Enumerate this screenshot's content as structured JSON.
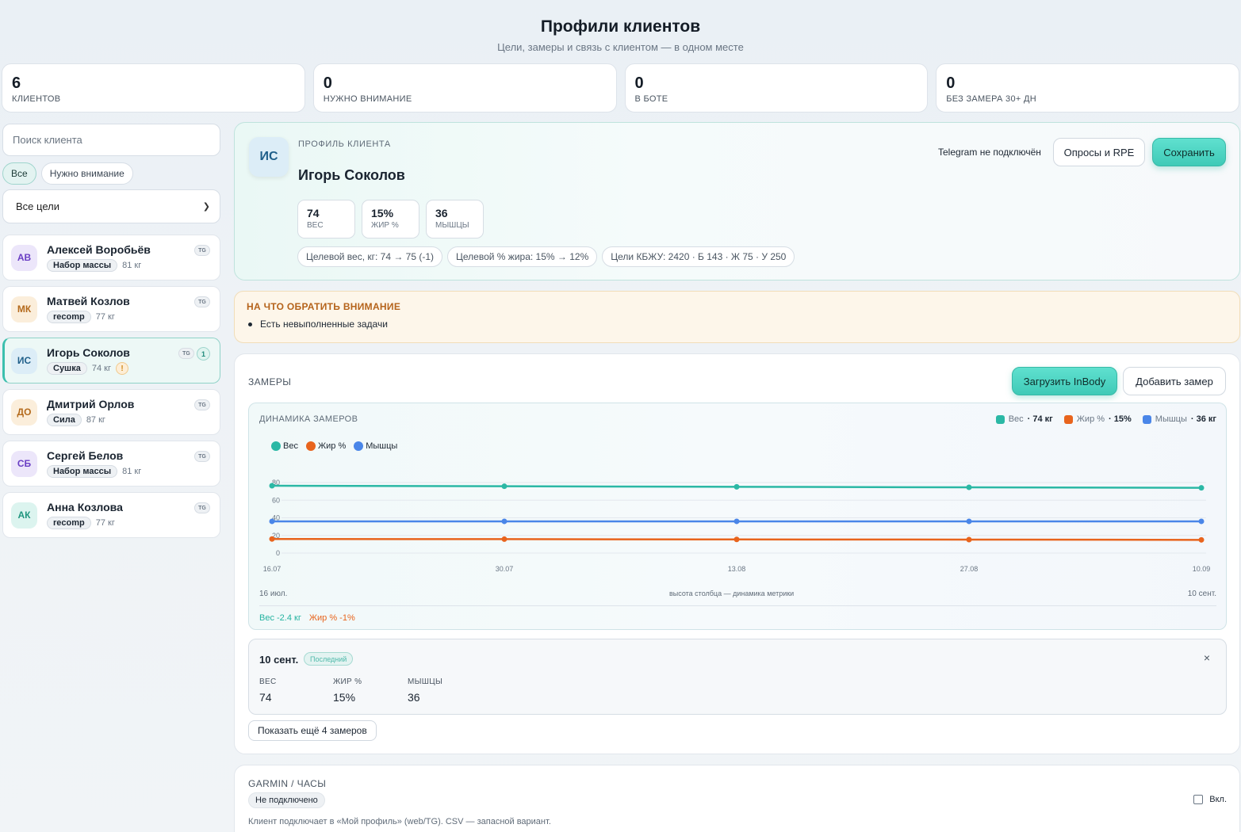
{
  "header": {
    "title": "Профили клиентов",
    "subtitle": "Цели, замеры и связь с клиентом — в одном месте"
  },
  "stats": [
    {
      "value": "6",
      "label": "КЛИЕНТОВ"
    },
    {
      "value": "0",
      "label": "НУЖНО ВНИМАНИЕ"
    },
    {
      "value": "0",
      "label": "В БОТЕ"
    },
    {
      "value": "0",
      "label": "БЕЗ ЗАМЕРА 30+ ДН"
    }
  ],
  "sidebar": {
    "search_placeholder": "Поиск клиента",
    "filters": [
      "Все",
      "Нужно внимание"
    ],
    "goal_select": "Все цели",
    "clients": [
      {
        "initials": "АВ",
        "name": "Алексей Воробьёв",
        "goal": "Набор массы",
        "weight": "81 кг",
        "tg": "TG",
        "avatar_bg": "#ece6fa",
        "avatar_fg": "#6a3fc4"
      },
      {
        "initials": "МК",
        "name": "Матвей Козлов",
        "goal": "recomp",
        "weight": "77 кг",
        "tg": "TG",
        "avatar_bg": "#fbeedb",
        "avatar_fg": "#b46a1c"
      },
      {
        "initials": "ИС",
        "name": "Игорь Соколов",
        "goal": "Сушка",
        "weight": "74 кг",
        "tg": "TG",
        "count": "1",
        "warn": "!",
        "avatar_bg": "#dcedf7",
        "avatar_fg": "#1f5f8a"
      },
      {
        "initials": "ДО",
        "name": "Дмитрий Орлов",
        "goal": "Сила",
        "weight": "87 кг",
        "tg": "TG",
        "avatar_bg": "#fbeedb",
        "avatar_fg": "#b46a1c"
      },
      {
        "initials": "СБ",
        "name": "Сергей Белов",
        "goal": "Набор массы",
        "weight": "81 кг",
        "tg": "TG",
        "avatar_bg": "#ece6fa",
        "avatar_fg": "#6a3fc4"
      },
      {
        "initials": "АК",
        "name": "Анна Козлова",
        "goal": "recomp",
        "weight": "77 кг",
        "tg": "TG",
        "avatar_bg": "#dcf4ef",
        "avatar_fg": "#21967f"
      }
    ]
  },
  "profile": {
    "initials": "ИС",
    "eyebrow": "ПРОФИЛЬ КЛИЕНТА",
    "name": "Игорь Соколов",
    "metrics": [
      {
        "value": "74",
        "label": "ВЕС"
      },
      {
        "value": "15%",
        "label": "ЖИР %"
      },
      {
        "value": "36",
        "label": "МЫШЦЫ"
      }
    ],
    "goals": [
      "Целевой вес, кг: 74 → 75 (-1)",
      "Целевой % жира: 15% → 12%",
      "Цели КБЖУ: 2420 · Б 143 · Ж 75 · У 250"
    ],
    "telegram_status": "Telegram не подключён",
    "surveys_button": "Опросы и RPE",
    "save_button": "Сохранить"
  },
  "attention": {
    "title": "НА ЧТО ОБРАТИТЬ ВНИМАНИЕ",
    "items": [
      "Есть невыполненные задачи"
    ]
  },
  "measurements": {
    "title": "ЗАМЕРЫ",
    "upload_button": "Загрузить InBody",
    "add_button": "Добавить замер",
    "chart_title": "ДИНАМИКА ЗАМЕРОВ",
    "summary": [
      {
        "name": "Вес",
        "value": "· 74 кг",
        "color": "#2bb8a5"
      },
      {
        "name": "Жир %",
        "value": "· 15%",
        "color": "#e8641d"
      },
      {
        "name": "Мышцы",
        "value": "· 36 кг",
        "color": "#4a86e8"
      }
    ],
    "foot_left": "16 июл.",
    "foot_mid": "высота столбца — динамика метрики",
    "foot_right": "10 сент.",
    "delta_weight": "Вес -2.4 кг",
    "delta_fat": "Жир % -1%",
    "last": {
      "date": "10 сент.",
      "tag": "Последний",
      "close": "×",
      "values": [
        {
          "label": "ВЕС",
          "value": "74"
        },
        {
          "label": "ЖИР %",
          "value": "15%"
        },
        {
          "label": "МЫШЦЫ",
          "value": "36"
        }
      ]
    },
    "more_button": "Показать ещё 4 замеров"
  },
  "chart_data": {
    "type": "line",
    "x": [
      "16.07",
      "30.07",
      "13.08",
      "27.08",
      "10.09"
    ],
    "yticks": [
      0,
      20,
      40,
      60,
      80
    ],
    "ylim": [
      0,
      80
    ],
    "series": [
      {
        "name": "Вес",
        "color": "#2bb8a5",
        "values": [
          76.4,
          75.8,
          75.2,
          74.6,
          74
        ]
      },
      {
        "name": "Жир %",
        "color": "#e8641d",
        "values": [
          16,
          15.8,
          15.5,
          15.3,
          15
        ]
      },
      {
        "name": "Мышцы",
        "color": "#4a86e8",
        "values": [
          36,
          36,
          36,
          36,
          36
        ]
      }
    ],
    "grid": true,
    "legend": "top-left"
  },
  "garmin": {
    "title": "GARMIN / ЧАСЫ",
    "status": "Не подключено",
    "description": "Клиент подключает в «Мой профиль» (web/TG). CSV — запасной вариант.",
    "toggle_label": "Вкл."
  }
}
